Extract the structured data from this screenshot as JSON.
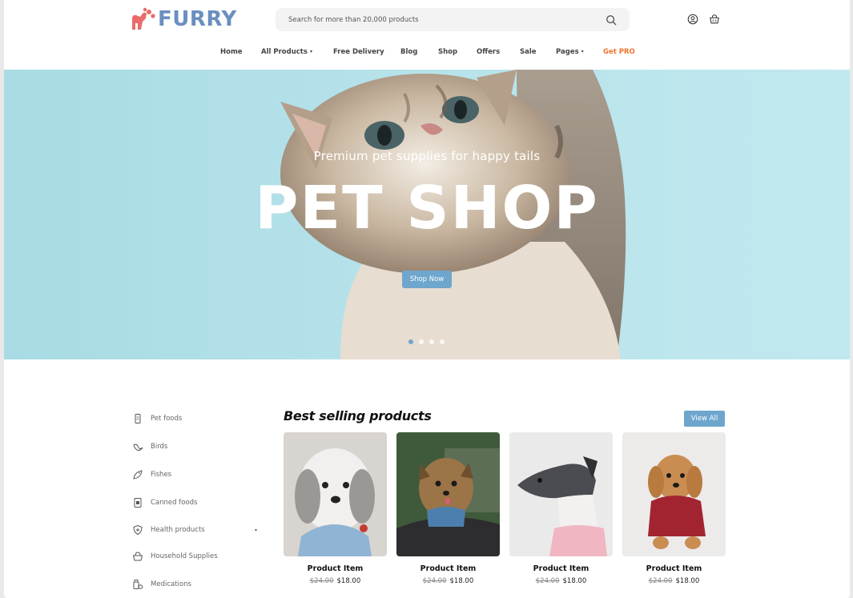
{
  "brand": {
    "name": "FURRY",
    "color": "#6a8fc0",
    "accent": "#e96b6b"
  },
  "search": {
    "placeholder": "Search for more than 20,000 products"
  },
  "nav": [
    {
      "label": "Home"
    },
    {
      "label": "All Products",
      "caret": "▾"
    },
    {
      "label": "Free Delivery"
    },
    {
      "label": "Blog"
    },
    {
      "label": "Shop"
    },
    {
      "label": "Offers"
    },
    {
      "label": "Sale"
    },
    {
      "label": "Pages",
      "caret": "▾"
    },
    {
      "label": "Get PRO",
      "color": "#f0732e"
    }
  ],
  "hero": {
    "subtitle": "Premium pet supplies for happy tails",
    "title": "PET SHOP",
    "button": "Shop Now",
    "slides": 4,
    "active_slide": 1
  },
  "sidebar": {
    "categories": [
      {
        "label": "Pet foods",
        "icon": "pet-food-icon"
      },
      {
        "label": "Birds",
        "icon": "bird-icon"
      },
      {
        "label": "Fishes",
        "icon": "fish-icon"
      },
      {
        "label": "Canned foods",
        "icon": "canned-food-icon"
      },
      {
        "label": "Health products",
        "icon": "health-shield-icon",
        "caret": "▾"
      },
      {
        "label": "Household Supplies",
        "icon": "basket-icon"
      },
      {
        "label": "Medications",
        "icon": "medication-icon"
      }
    ]
  },
  "products": {
    "title": "Best selling products",
    "view_all": "View All",
    "items": [
      {
        "name": "Product Item",
        "old_price": "$24.00",
        "price": "$18.00"
      },
      {
        "name": "Product Item",
        "old_price": "$24.00",
        "price": "$18.00"
      },
      {
        "name": "Product Item",
        "old_price": "$24.00",
        "price": "$18.00"
      },
      {
        "name": "Product Item",
        "old_price": "$24.00",
        "price": "$18.00"
      }
    ]
  },
  "colors": {
    "button": "#6ea6cd",
    "hero_bg": "#b6e2ea",
    "pro": "#f0732e"
  }
}
